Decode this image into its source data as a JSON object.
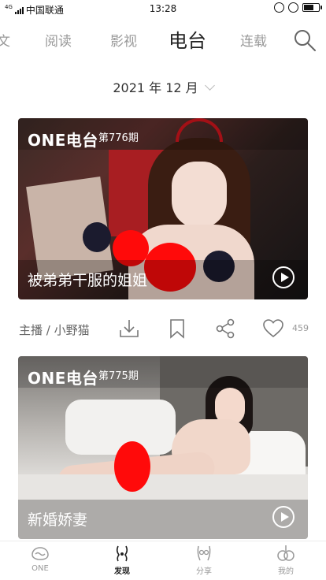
{
  "status_bar": {
    "network": "4G",
    "carrier": "中国联通",
    "time": "13:28",
    "battery_level": 0.7
  },
  "tabs": [
    {
      "label": "文",
      "active": false
    },
    {
      "label": "阅读",
      "active": false
    },
    {
      "label": "影视",
      "active": false
    },
    {
      "label": "电台",
      "active": true
    },
    {
      "label": "连载",
      "active": false
    }
  ],
  "search_icon": "search-icon",
  "month_header": {
    "label": "2021 年 12 月"
  },
  "cards": [
    {
      "logo": "ONE电台",
      "issue": "第776期",
      "title": "被弟弟干服的姐姐",
      "host": "主播 / 小野猫",
      "like_count": "459"
    },
    {
      "logo": "ONE电台",
      "issue": "第775期",
      "title": "新婚娇妻"
    }
  ],
  "bottom_nav": [
    {
      "label": "ONE",
      "icon": "one-icon",
      "active": false
    },
    {
      "label": "发现",
      "icon": "discover-icon",
      "active": true
    },
    {
      "label": "分享",
      "icon": "share-icon",
      "active": false
    },
    {
      "label": "我的",
      "icon": "profile-icon",
      "active": false
    }
  ],
  "colors": {
    "accent": "#222222",
    "muted": "#999999",
    "censor": "#ff0a0a"
  }
}
